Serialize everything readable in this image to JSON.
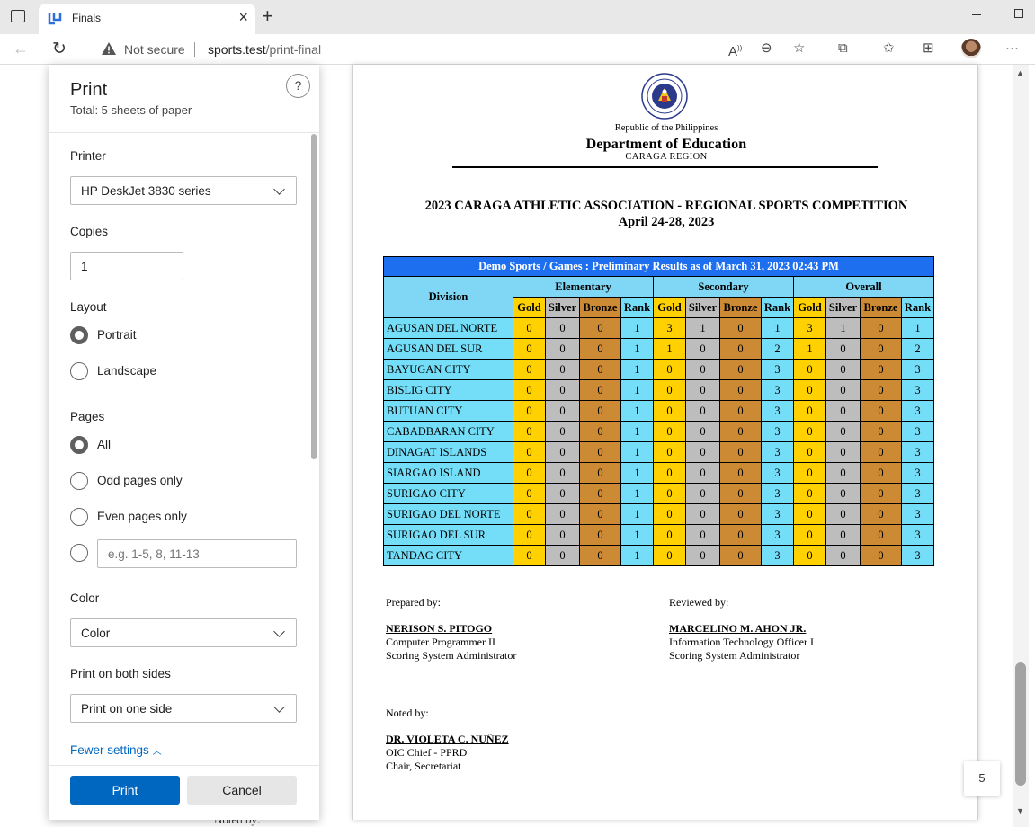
{
  "browser": {
    "tab_title": "Finals",
    "security_text": "Not secure",
    "url_host": "sports.test",
    "url_path": "/print-final"
  },
  "print": {
    "title": "Print",
    "total": "Total: 5 sheets of paper",
    "help": "?",
    "printer_label": "Printer",
    "printer_value": "HP DeskJet 3830 series",
    "copies_label": "Copies",
    "copies_value": "1",
    "layout_label": "Layout",
    "layout_portrait": "Portrait",
    "layout_landscape": "Landscape",
    "pages_label": "Pages",
    "pages_all": "All",
    "pages_odd": "Odd pages only",
    "pages_even": "Even pages only",
    "pages_custom_placeholder": "e.g. 1-5, 8, 11-13",
    "color_label": "Color",
    "color_value": "Color",
    "duplex_label": "Print on both sides",
    "duplex_value": "Print on one side",
    "fewer_settings": "Fewer settings",
    "print_button": "Print",
    "cancel_button": "Cancel"
  },
  "document": {
    "republic": "Republic of the Philippines",
    "department": "Department of Education",
    "region": "CARAGA REGION",
    "competition": "2023 CARAGA ATHLETIC ASSOCIATION - REGIONAL SPORTS COMPETITION",
    "dates": "April 24-28, 2023",
    "table_caption": "Demo Sports / Games : Preliminary Results as of March 31, 2023 02:43 PM",
    "division_header": "Division",
    "group_headers": [
      "Elementary",
      "Secondary",
      "Overall"
    ],
    "medal_headers": [
      "Gold",
      "Silver",
      "Bronze",
      "Rank"
    ],
    "rows": [
      {
        "division": "AGUSAN DEL NORTE",
        "values": [
          0,
          0,
          0,
          1,
          3,
          1,
          0,
          1,
          3,
          1,
          0,
          1
        ]
      },
      {
        "division": "AGUSAN DEL SUR",
        "values": [
          0,
          0,
          0,
          1,
          1,
          0,
          0,
          2,
          1,
          0,
          0,
          2
        ]
      },
      {
        "division": "BAYUGAN CITY",
        "values": [
          0,
          0,
          0,
          1,
          0,
          0,
          0,
          3,
          0,
          0,
          0,
          3
        ]
      },
      {
        "division": "BISLIG CITY",
        "values": [
          0,
          0,
          0,
          1,
          0,
          0,
          0,
          3,
          0,
          0,
          0,
          3
        ]
      },
      {
        "division": "BUTUAN CITY",
        "values": [
          0,
          0,
          0,
          1,
          0,
          0,
          0,
          3,
          0,
          0,
          0,
          3
        ]
      },
      {
        "division": "CABADBARAN CITY",
        "values": [
          0,
          0,
          0,
          1,
          0,
          0,
          0,
          3,
          0,
          0,
          0,
          3
        ]
      },
      {
        "division": "DINAGAT ISLANDS",
        "values": [
          0,
          0,
          0,
          1,
          0,
          0,
          0,
          3,
          0,
          0,
          0,
          3
        ]
      },
      {
        "division": "SIARGAO ISLAND",
        "values": [
          0,
          0,
          0,
          1,
          0,
          0,
          0,
          3,
          0,
          0,
          0,
          3
        ]
      },
      {
        "division": "SURIGAO CITY",
        "values": [
          0,
          0,
          0,
          1,
          0,
          0,
          0,
          3,
          0,
          0,
          0,
          3
        ]
      },
      {
        "division": "SURIGAO DEL NORTE",
        "values": [
          0,
          0,
          0,
          1,
          0,
          0,
          0,
          3,
          0,
          0,
          0,
          3
        ]
      },
      {
        "division": "SURIGAO DEL SUR",
        "values": [
          0,
          0,
          0,
          1,
          0,
          0,
          0,
          3,
          0,
          0,
          0,
          3
        ]
      },
      {
        "division": "TANDAG CITY",
        "values": [
          0,
          0,
          0,
          1,
          0,
          0,
          0,
          3,
          0,
          0,
          0,
          3
        ]
      }
    ],
    "prepared": {
      "label": "Prepared by:",
      "name": "NERISON S. PITOGO",
      "line1": "Computer Programmer II",
      "line2": "Scoring System Administrator"
    },
    "reviewed": {
      "label": "Reviewed by:",
      "name": "MARCELINO M. AHON JR.",
      "line1": "Information Technology Officer I",
      "line2": "Scoring System Administrator"
    },
    "noted": {
      "label": "Noted by:",
      "name": "DR. VIOLETA C. NUÑEZ",
      "line1": "OIC Chief - PPRD",
      "line2": "Chair, Secretariat"
    }
  },
  "behind_text": "Noted by:",
  "page_count": "5",
  "colors": {
    "accent": "#0067c0",
    "caption_bg": "#1e6ef0",
    "header_bg": "#7fd7f5",
    "gold": "#ffd100",
    "silver": "#bdbdbd",
    "bronze": "#cd8a35",
    "cyan": "#74def8"
  }
}
